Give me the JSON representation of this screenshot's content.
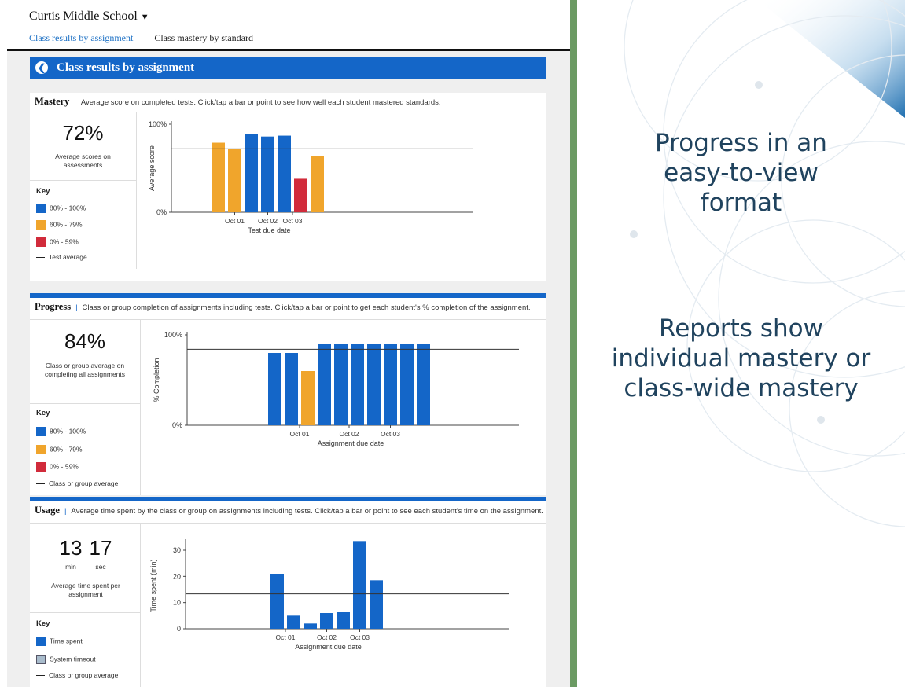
{
  "header": {
    "school": "Curtis Middle School",
    "tabs": [
      "Class results by assignment",
      "Class mastery by standard"
    ]
  },
  "title": "Class results by assignment",
  "mastery": {
    "heading": "Mastery",
    "description": "Average score on completed tests. Click/tap a bar or point to see how well each student mastered standards.",
    "value": "72%",
    "value_label": "Average scores on assessments",
    "key_title": "Key",
    "key": [
      "80% - 100%",
      "60% - 79%",
      "0% - 59%",
      "Test average"
    ]
  },
  "progress": {
    "heading": "Progress",
    "description": "Class or group completion of assignments including tests. Click/tap a bar or point to get each student's % completion of the assignment.",
    "value": "84%",
    "value_label": "Class or group average on completing all assignments",
    "key_title": "Key",
    "key": [
      "80% - 100%",
      "60% - 79%",
      "0% - 59%",
      "Class or group average"
    ]
  },
  "usage": {
    "heading": "Usage",
    "description": "Average time spent by the class or group on assignments including tests. Click/tap a bar or point to see each student's time on the assignment.",
    "minutes": "13",
    "seconds": "17",
    "min_label": "min",
    "sec_label": "sec",
    "value_label": "Average time spent per assignment",
    "key_title": "Key",
    "key": [
      "Time spent",
      "System timeout",
      "Class or group average"
    ]
  },
  "slide": {
    "text1": [
      "Progress in an",
      "easy-to-view",
      "format"
    ],
    "text2": [
      "Reports show",
      "individual mastery or",
      "class-wide mastery"
    ]
  },
  "colors": {
    "high": "#1466c8",
    "mid": "#f0a52c",
    "low": "#d12b3b",
    "timeout": "#a9bccc",
    "avg": "#333333",
    "slide_text": "#20435e"
  },
  "chart_data": [
    {
      "type": "bar",
      "name_ref": "mastery",
      "ylabel": "Average score",
      "xlabel": "Test due date",
      "ylim": [
        0,
        100
      ],
      "yticks": [
        "0%",
        "100%"
      ],
      "xticklabels": [
        {
          "label": "Oct 01",
          "after_bar": 1.5
        },
        {
          "label": "Oct 02",
          "after_bar": 3.5
        },
        {
          "label": "Oct 03",
          "after_bar": 5.0
        }
      ],
      "values": [
        79,
        72,
        89,
        86,
        87,
        38,
        64
      ],
      "bands": [
        "mid",
        "mid",
        "high",
        "high",
        "high",
        "low",
        "mid"
      ],
      "average": 72
    },
    {
      "type": "bar",
      "name_ref": "progress",
      "ylabel": "% Completion",
      "xlabel": "Assignment due date",
      "ylim": [
        0,
        100
      ],
      "yticks": [
        "0%",
        "100%"
      ],
      "xticklabels": [
        {
          "label": "Oct 01",
          "after_bar": 2.0
        },
        {
          "label": "Oct 02",
          "after_bar": 5.0
        },
        {
          "label": "Oct 03",
          "after_bar": 7.5
        }
      ],
      "values": [
        80,
        80,
        60,
        90,
        90,
        90,
        90,
        90,
        90,
        90
      ],
      "bands": [
        "high",
        "high",
        "mid",
        "high",
        "high",
        "high",
        "high",
        "high",
        "high",
        "high"
      ],
      "average": 84
    },
    {
      "type": "bar",
      "name_ref": "usage",
      "ylabel": "Time spent (min)",
      "xlabel": "Assignment due date",
      "ylim": [
        0,
        33
      ],
      "yticks": [
        "0",
        "10",
        "20",
        "30"
      ],
      "ytickvalues": [
        0,
        10,
        20,
        30
      ],
      "xticklabels": [
        {
          "label": "Oct 01",
          "after_bar": 1.0
        },
        {
          "label": "Oct 02",
          "after_bar": 3.5
        },
        {
          "label": "Oct 03",
          "after_bar": 5.5
        }
      ],
      "values": [
        21,
        5,
        2,
        6,
        6.5,
        33.5,
        18.5
      ],
      "bands": [
        "high",
        "high",
        "high",
        "high",
        "high",
        "high",
        "high"
      ],
      "average": 13.3
    }
  ]
}
